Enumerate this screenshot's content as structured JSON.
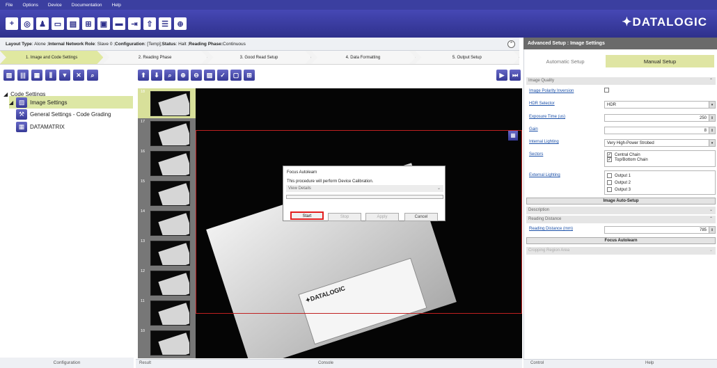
{
  "menu": [
    "File",
    "Options",
    "Device",
    "Documentation",
    "Help"
  ],
  "brand": "✦DATALOGIC",
  "infobar": {
    "k1": "Layout Type",
    "v1": ": Alone ; ",
    "k2": "Internal Network Role",
    "v2": ": Slave 0 ; ",
    "k3": "Configuration",
    "v3": ": [Temp]; ",
    "k4": "Status",
    "v4": ": Halt ; ",
    "k5": "Reading Phase:",
    "v5": " Continuous"
  },
  "steps": [
    "1. Image and Code Settings",
    "2. Reading Phase",
    "3. Good Read Setup",
    "4. Data Formatting",
    "5. Output Setup"
  ],
  "tree": {
    "root": "Code Settings",
    "image": "Image Settings",
    "general": "General Settings - Code Grading",
    "dm": "DATAMATRIX"
  },
  "left_footer": "Configuration",
  "thumbs": [
    "18",
    "17",
    "16",
    "15",
    "14",
    "13",
    "12",
    "11",
    "10"
  ],
  "dialog": {
    "title": "Focus Autolearn",
    "msg": "This procedure will perform Device Calibration.",
    "details": "View Details",
    "start": "Start",
    "stop": "Stop",
    "apply": "Apply",
    "cancel": "Cancel"
  },
  "label_text": "✦DATALOGIC",
  "result_tabs": {
    "result": "Result",
    "console": "Console"
  },
  "right": {
    "title": "Advanced Setup : Image Settings",
    "auto_tab": "Automatic Setup",
    "manual_tab": "Manual Setup",
    "sec_image_quality": "Image Quality",
    "l_polarity": "Image Polarity Inversion",
    "l_hdr": "HDR Selector",
    "v_hdr": "HDR",
    "l_exposure": "Exposure Time (us)",
    "v_exposure": "250",
    "l_gain": "Gain",
    "v_gain": "8",
    "l_lighting": "Internal Lighting",
    "v_lighting": "Very High-Power Strobed",
    "l_sectors": "Sectors",
    "s1": "Central Chain",
    "s2": "Top/Bottom Chain",
    "l_ext": "External Lighting",
    "o1": "Output 1",
    "o2": "Output 2",
    "o3": "Output 3",
    "btn_auto_setup": "Image Auto-Setup",
    "sec_desc": "Description",
    "sec_reading": "Reading Distance",
    "l_distance": "Reading Distance (mm)",
    "v_distance": "785",
    "btn_focus": "Focus Autolearn",
    "sec_crop": "Cropping Region Area",
    "foot_control": "Control",
    "foot_help": "Help"
  }
}
